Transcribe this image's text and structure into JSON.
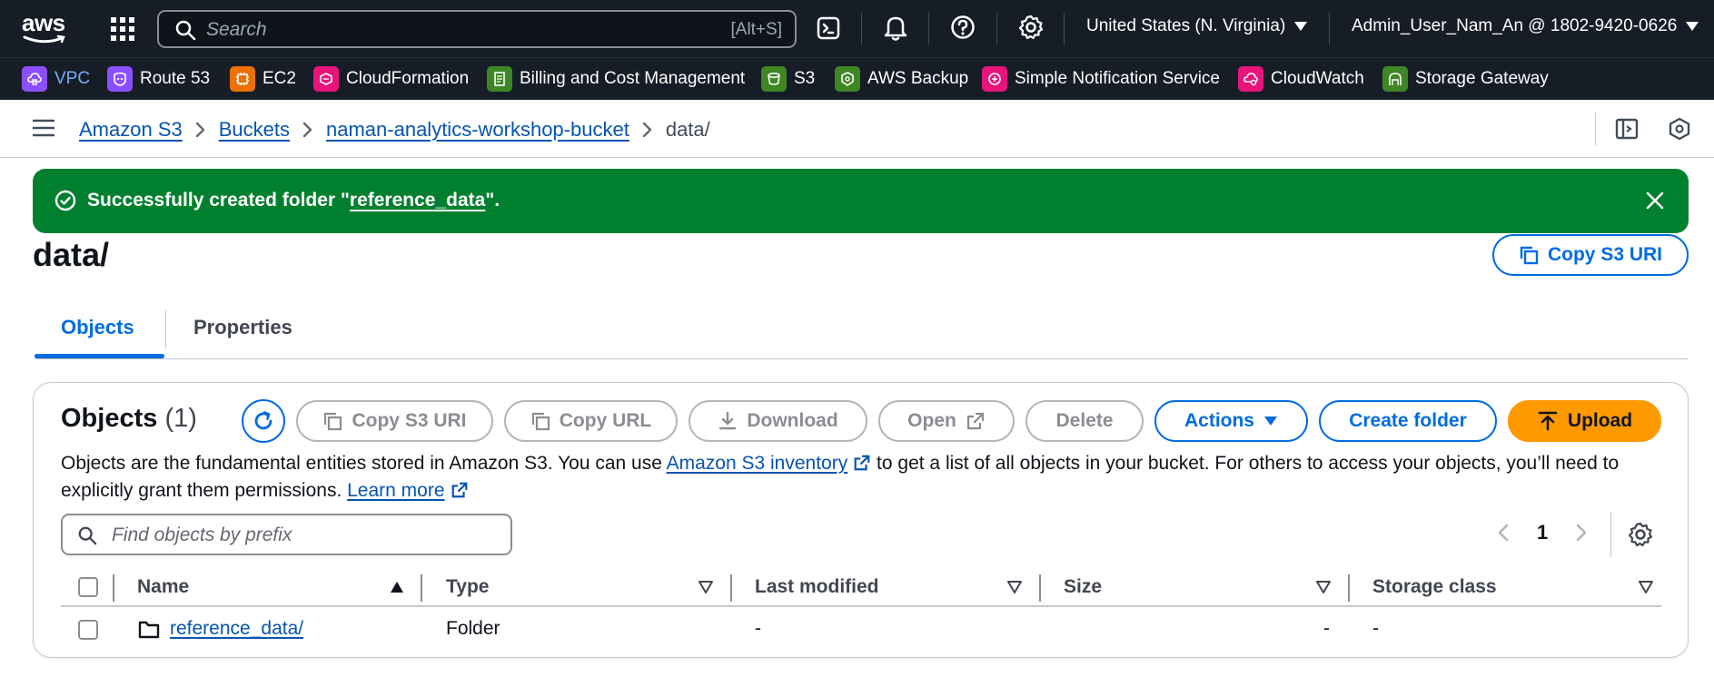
{
  "topbar": {
    "logo_text": "aws",
    "search_placeholder": "Search",
    "search_shortcut": "[Alt+S]",
    "region": "United States (N. Virginia)",
    "account": "Admin_User_Nam_An @ 1802-9420-0626"
  },
  "favorites": [
    {
      "label": "VPC",
      "color": "#8c4fff",
      "icon": "vpc-icon"
    },
    {
      "label": "Route 53",
      "color": "#8c4fff",
      "icon": "route53-icon"
    },
    {
      "label": "EC2",
      "color": "#ed7100",
      "icon": "ec2-icon"
    },
    {
      "label": "CloudFormation",
      "color": "#e7157b",
      "icon": "cloudformation-icon"
    },
    {
      "label": "Billing and Cost Management",
      "color": "#3f8624",
      "icon": "billing-icon"
    },
    {
      "label": "S3",
      "color": "#3f8624",
      "icon": "s3-icon"
    },
    {
      "label": "AWS Backup",
      "color": "#3f8624",
      "icon": "backup-icon"
    },
    {
      "label": "Simple Notification Service",
      "color": "#e7157b",
      "icon": "sns-icon"
    },
    {
      "label": "CloudWatch",
      "color": "#e7157b",
      "icon": "cloudwatch-icon"
    },
    {
      "label": "Storage Gateway",
      "color": "#3f8624",
      "icon": "storage-gateway-icon"
    }
  ],
  "breadcrumb": {
    "items": [
      "Amazon S3",
      "Buckets",
      "naman-analytics-workshop-bucket"
    ],
    "current": "data/"
  },
  "flash": {
    "prefix": "Successfully created folder \"",
    "folder": "reference_data",
    "suffix": "\".",
    "color": "#00802f"
  },
  "page": {
    "title": "data/",
    "copy_uri_label": "Copy S3 URI"
  },
  "tabs": [
    {
      "label": "Objects",
      "active": true
    },
    {
      "label": "Properties",
      "active": false
    }
  ],
  "objects": {
    "title": "Objects",
    "count": "(1)",
    "buttons": {
      "copy_uri": "Copy S3 URI",
      "copy_url": "Copy URL",
      "download": "Download",
      "open": "Open",
      "delete": "Delete",
      "actions": "Actions",
      "create_folder": "Create folder",
      "upload": "Upload"
    },
    "description": {
      "part1": "Objects are the fundamental entities stored in Amazon S3. You can use ",
      "inventory_link": "Amazon S3 inventory",
      "part2": " to get a list of all objects in your bucket. For others to access your objects, you’ll need to explicitly grant them permissions. ",
      "learn_more": "Learn more"
    },
    "filter_placeholder": "Find objects by prefix",
    "page_number": "1",
    "columns": [
      "Name",
      "Type",
      "Last modified",
      "Size",
      "Storage class"
    ],
    "rows": [
      {
        "name": "reference_data/",
        "type": "Folder",
        "last_modified": "-",
        "size": "-",
        "storage_class": "-"
      }
    ]
  },
  "colors": {
    "accent": "#006ce0",
    "link": "#0654b2",
    "nav_bg": "#161d26",
    "upload": "#ff9900"
  }
}
